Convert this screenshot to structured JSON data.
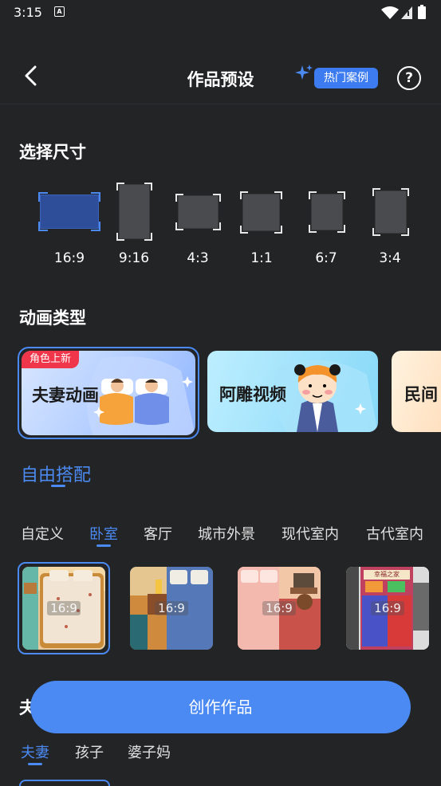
{
  "status_bar": {
    "time": "3:15",
    "notif_icon": "A"
  },
  "header": {
    "title": "作品预设",
    "hot_cases": "热门案例",
    "help": "?"
  },
  "size_section": {
    "title": "选择尺寸",
    "options": [
      {
        "label": "16:9",
        "selected": true
      },
      {
        "label": "9:16",
        "selected": false
      },
      {
        "label": "4:3",
        "selected": false
      },
      {
        "label": "1:1",
        "selected": false
      },
      {
        "label": "6:7",
        "selected": false
      },
      {
        "label": "3:4",
        "selected": false
      }
    ]
  },
  "animation_section": {
    "title": "动画类型",
    "cards": [
      {
        "label": "夫妻动画",
        "badge": "角色上新",
        "selected": true
      },
      {
        "label": "阿雕视频"
      },
      {
        "label": "民间"
      }
    ]
  },
  "free_match": {
    "label": "自由搭配"
  },
  "scene_tabs": {
    "items": [
      "自定义",
      "卧室",
      "客厅",
      "城市外景",
      "现代室内",
      "古代室内"
    ],
    "active_index": 1
  },
  "thumbnails": {
    "ratio_label": "16:9",
    "sign_text": "幸福之家",
    "count": 4
  },
  "create_button": {
    "label": "创作作品"
  },
  "role_section": {
    "title_partial": "夫",
    "tabs": [
      "夫妻",
      "孩子",
      "婆子妈"
    ],
    "active_index": 0
  },
  "colors": {
    "accent": "#4b8af2",
    "background": "#232426",
    "badge_red": "#f0364a"
  }
}
